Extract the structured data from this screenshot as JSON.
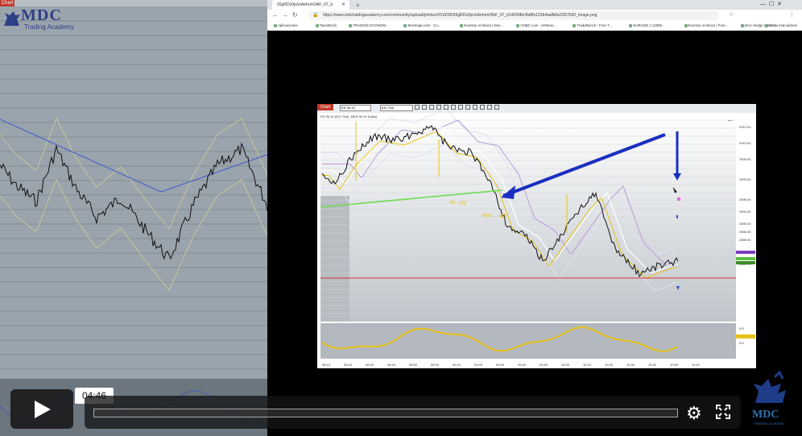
{
  "left_chart": {
    "tab_label": "Chart",
    "logo_text": "MDC",
    "logo_subtitle": "Trading Academy"
  },
  "browser": {
    "tab_title": "55gRDz0pcIsAehrmOlkF_07_b",
    "url": "https://www.mdctradingacademy.com/community/upload/photos/2019/05/55gRDz0pcIsAehrmOlkF_07_b140998e3fa8fe123b4aa8b5e2557b92_image.png",
    "bookmarks": [
      "Aplicaciones",
      "TweetDeck",
      "TRADING ECONOM...",
      "Benzinga.com - Co...",
      "Eventos Archivos | Nov...",
      "CNBC Live - USNew...",
      "TradeBench - Free T...",
      "EURUSD 1.12050...",
      "Eventos Archivos | Fore...",
      "Zero Hedge | On a l...",
      "Otros marcadores"
    ]
  },
  "inner_chart": {
    "tab_label": "Chart",
    "symbol": "ES 06-19",
    "interval": "610 Tick",
    "title": "ES 06-19 (610 Tick), MES 06-19 (Daily)",
    "annotation_1": "Alc. yyy",
    "annotation_2": "Mov..... yyy",
    "price_ticks": [
      "2912.00",
      "2910.00",
      "2905.00",
      "2900.00",
      "2895.00",
      "2892.00",
      "2890.00",
      "2886.50",
      "2885.00",
      "2882.50",
      "2880.00"
    ],
    "time_ticks": [
      "08:10",
      "08:20",
      "08:30",
      "08:40",
      "08:50",
      "09:00",
      "09:10",
      "09:20",
      "09:30",
      "09:40",
      "09:50",
      "10:00",
      "10:10",
      "10:20",
      "10:30",
      "10:40",
      "10:50",
      "11:00"
    ],
    "osc_values": [
      "0.5",
      "0.151",
      "0.5"
    ]
  },
  "player": {
    "timecode": "04:46",
    "progress": 0.0
  },
  "badge": {
    "text": "MDC",
    "subtitle": "TRADING ACADEMY"
  },
  "colors": {
    "accent_red": "#c0392b",
    "arrow_blue": "#1a2fbf",
    "osc_yellow": "#e7c21a"
  }
}
